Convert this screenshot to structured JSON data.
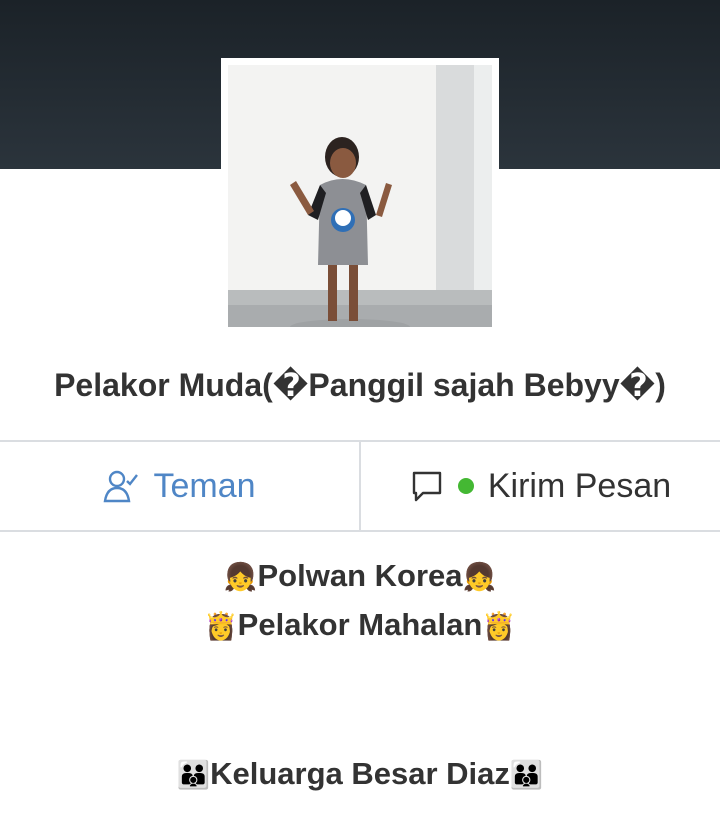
{
  "profile": {
    "name": "Pelakor Muda(�Panggil sajah Bebyy�)"
  },
  "actions": {
    "friend_label": "Teman",
    "message_label": "Kirim Pesan",
    "online_color": "#44b833"
  },
  "bio": {
    "line1": {
      "prefix": "👧",
      "text": "Polwan Korea",
      "suffix": "👧"
    },
    "line2": {
      "prefix": "👸",
      "text": "Pelakor Mahalan",
      "suffix": "👸"
    },
    "line3": {
      "prefix": "👪",
      "text": "Keluarga Besar Diaz",
      "suffix": "👪"
    }
  }
}
